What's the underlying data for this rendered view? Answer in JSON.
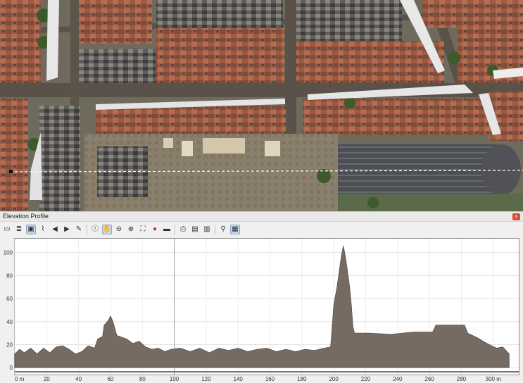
{
  "window": {
    "dock_title": "Elevation Profile",
    "close_label": "×"
  },
  "toolbar": {
    "buttons": [
      {
        "icon": "capture-curve-icon",
        "glyph": "▭"
      },
      {
        "icon": "layer-tree-icon",
        "glyph": "≣"
      },
      {
        "icon": "capture-from-feature-icon",
        "glyph": "▣",
        "active": true
      },
      {
        "icon": "snap-curve-icon",
        "glyph": "⌇"
      },
      {
        "icon": "nudge-left-icon",
        "glyph": "◀"
      },
      {
        "icon": "nudge-right-icon",
        "glyph": "▶"
      },
      {
        "icon": "clear-icon",
        "glyph": "✎"
      },
      {
        "sep": true
      },
      {
        "icon": "identify-icon",
        "glyph": "ⓘ"
      },
      {
        "icon": "pan-icon",
        "glyph": "✋",
        "active": true
      },
      {
        "icon": "zoom-x-icon",
        "glyph": "⊖"
      },
      {
        "icon": "zoom-icon",
        "glyph": "⊕"
      },
      {
        "icon": "zoom-full-icon",
        "glyph": "⛶"
      },
      {
        "icon": "render-icon",
        "glyph": "●",
        "color": "#d03030"
      },
      {
        "icon": "measure-icon",
        "glyph": "▬"
      },
      {
        "sep": true
      },
      {
        "icon": "export-image-icon",
        "glyph": "⎙"
      },
      {
        "icon": "export-3d-icon",
        "glyph": "▤"
      },
      {
        "icon": "export-pdf-icon",
        "glyph": "▥"
      },
      {
        "sep": true
      },
      {
        "icon": "tolerance-icon",
        "glyph": "⚲"
      },
      {
        "icon": "settings-icon",
        "glyph": "▦",
        "active": true
      }
    ]
  },
  "chart_data": {
    "type": "profile",
    "x_tick_labels": [
      "0 m",
      "20",
      "40",
      "60",
      "80",
      "100",
      "120",
      "140",
      "160",
      "180",
      "200",
      "220",
      "240",
      "260",
      "280",
      "300 m"
    ],
    "y_tick_labels": [
      "0",
      "20",
      "40",
      "60",
      "80",
      "100"
    ],
    "x_ticks": [
      0,
      20,
      40,
      60,
      80,
      100,
      120,
      140,
      160,
      180,
      200,
      220,
      240,
      260,
      280,
      300
    ],
    "y_ticks": [
      0,
      20,
      40,
      60,
      80,
      100
    ],
    "xlim": [
      0,
      316
    ],
    "ylim": [
      -6,
      112
    ],
    "grid": true,
    "profile": [
      [
        0,
        12
      ],
      [
        3,
        16
      ],
      [
        6,
        13
      ],
      [
        10,
        17
      ],
      [
        14,
        12
      ],
      [
        18,
        17
      ],
      [
        22,
        13
      ],
      [
        26,
        18
      ],
      [
        30,
        19
      ],
      [
        34,
        16
      ],
      [
        38,
        12
      ],
      [
        42,
        14
      ],
      [
        46,
        19
      ],
      [
        50,
        17
      ],
      [
        52,
        25
      ],
      [
        55,
        27
      ],
      [
        56,
        37
      ],
      [
        58,
        40
      ],
      [
        59,
        42
      ],
      [
        60,
        45
      ],
      [
        61,
        42
      ],
      [
        62,
        38
      ],
      [
        64,
        28
      ],
      [
        66,
        27
      ],
      [
        70,
        25
      ],
      [
        74,
        21
      ],
      [
        78,
        23
      ],
      [
        82,
        18
      ],
      [
        86,
        16
      ],
      [
        90,
        17
      ],
      [
        94,
        14
      ],
      [
        98,
        16
      ],
      [
        104,
        17
      ],
      [
        110,
        14
      ],
      [
        116,
        17
      ],
      [
        122,
        13
      ],
      [
        128,
        17
      ],
      [
        134,
        15
      ],
      [
        140,
        17
      ],
      [
        146,
        14
      ],
      [
        152,
        16
      ],
      [
        158,
        17
      ],
      [
        164,
        14
      ],
      [
        170,
        16
      ],
      [
        176,
        14
      ],
      [
        182,
        16
      ],
      [
        188,
        15
      ],
      [
        194,
        17
      ],
      [
        198,
        18
      ],
      [
        199,
        36
      ],
      [
        200,
        55
      ],
      [
        202,
        70
      ],
      [
        203,
        80
      ],
      [
        204,
        90
      ],
      [
        205,
        99
      ],
      [
        206,
        106
      ],
      [
        207,
        99
      ],
      [
        208,
        90
      ],
      [
        209,
        80
      ],
      [
        210,
        70
      ],
      [
        211,
        55
      ],
      [
        212,
        36
      ],
      [
        213,
        30
      ],
      [
        222,
        30
      ],
      [
        236,
        29
      ],
      [
        250,
        31
      ],
      [
        262,
        31
      ],
      [
        264,
        37
      ],
      [
        268,
        37
      ],
      [
        276,
        37
      ],
      [
        282,
        37
      ],
      [
        284,
        30
      ],
      [
        290,
        26
      ],
      [
        296,
        21
      ],
      [
        302,
        17
      ],
      [
        306,
        18
      ],
      [
        308,
        15
      ],
      [
        310,
        12
      ]
    ],
    "reference_line_x": 100
  },
  "colors": {
    "ground": "#6e6a5c",
    "plot_bg": "#ffffff",
    "profile_fill": "#756b63"
  }
}
